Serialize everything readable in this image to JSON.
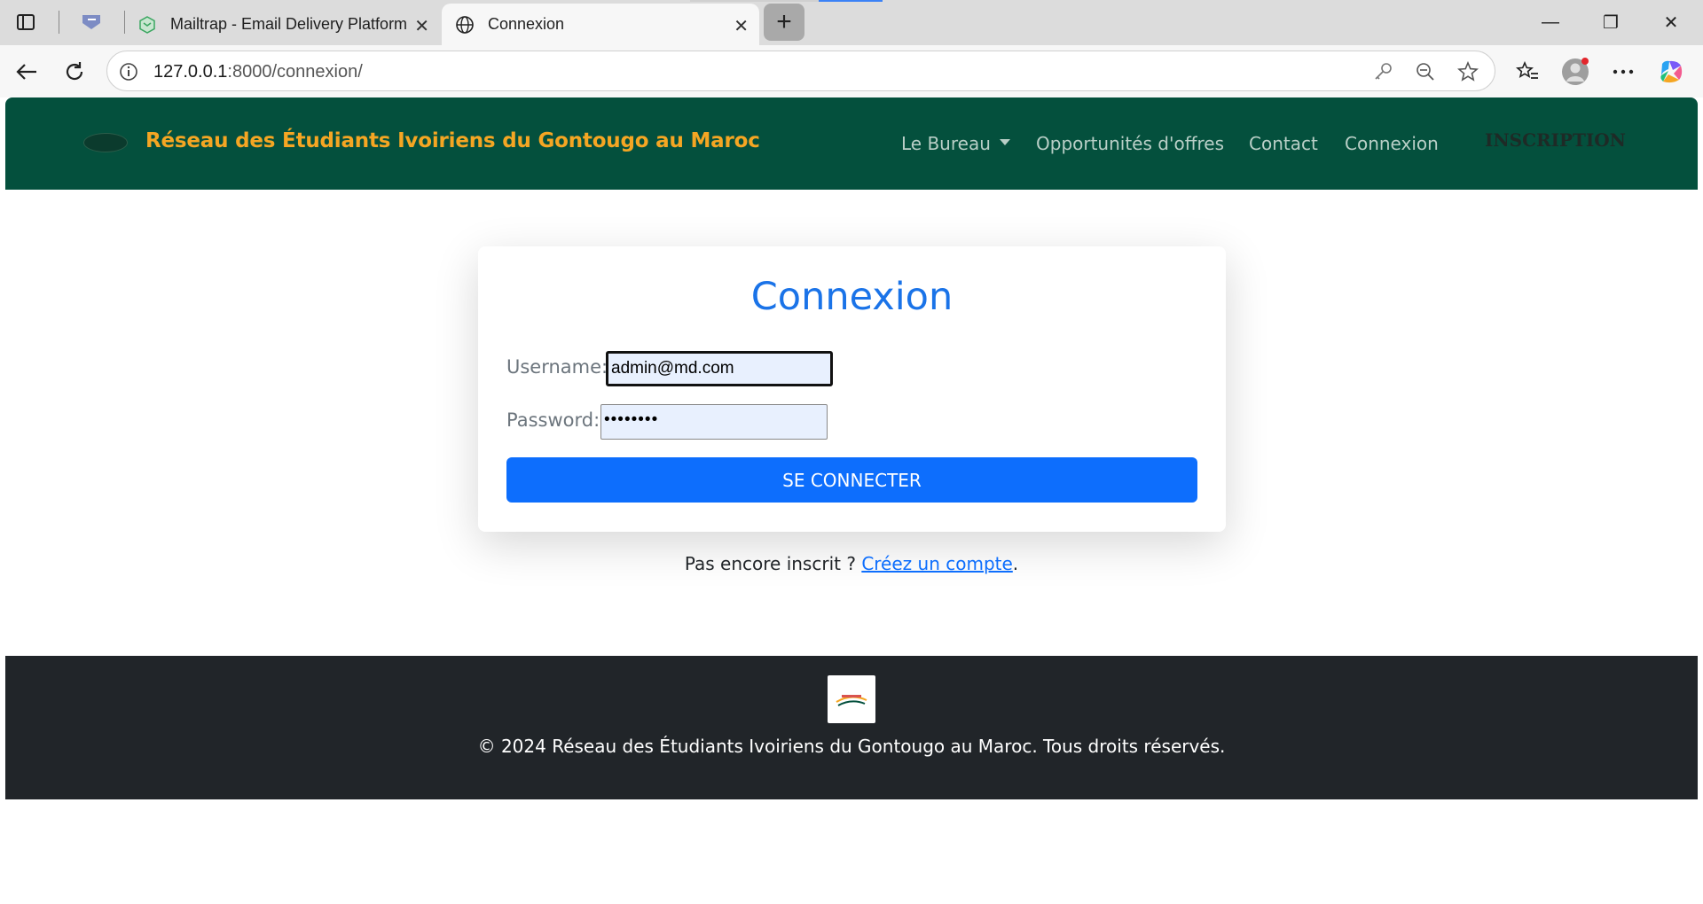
{
  "browser": {
    "tabs": [
      {
        "title": "Mailtrap - Email Delivery Platform",
        "icon": "mailtrap-icon"
      },
      {
        "title": "Connexion",
        "icon": "globe-icon"
      }
    ],
    "url_host": "127.0.0.1",
    "url_rest": ":8000/connexion/"
  },
  "navbar": {
    "brand": "Réseau des Étudiants Ivoiriens du Gontougo au Maroc",
    "items": [
      "Le Bureau",
      "Opportunités d'offres",
      "Contact",
      "Connexion"
    ],
    "cta": "INSCRIPTION",
    "colors": {
      "bg": "#04503d",
      "brand": "#f5a623"
    }
  },
  "login": {
    "title": "Connexion",
    "username_label": "Username:",
    "username_value": "admin@md.com",
    "password_label": "Password:",
    "password_value": "••••••••",
    "submit_label": "SE CONNECTER",
    "accent": "#0d6efd"
  },
  "signup": {
    "prefix": "Pas encore inscrit ?",
    "link": "Créez un compte",
    "suffix": "."
  },
  "footer": {
    "text": "© 2024 Réseau des Étudiants Ivoiriens du Gontougo au Maroc. Tous droits réservés."
  }
}
